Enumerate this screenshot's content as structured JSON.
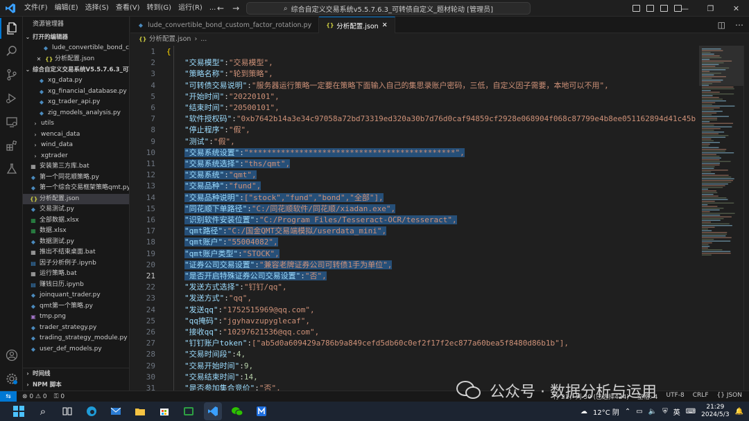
{
  "titlebar": {
    "menus": [
      "文件(F)",
      "编辑(E)",
      "选择(S)",
      "查看(V)",
      "转到(G)",
      "运行(R)",
      "..."
    ],
    "command_center": "综合自定义交易系统v5.5.7.6.3_可转债自定义_题材轮动 [管理员]"
  },
  "sidebar": {
    "header": "资源管理器",
    "open_editors_title": "打开的编辑器",
    "open_editors": [
      {
        "name": "lude_convertible_bond_c...",
        "type": "py"
      },
      {
        "name": "分析配置.json",
        "type": "json"
      }
    ],
    "workspace_title": "综合自定义交易系统V5.5.7.6.3_可转...",
    "files": [
      {
        "name": "xg_data.py",
        "type": "py",
        "kind": "file"
      },
      {
        "name": "xg_financial_database.py",
        "type": "py",
        "kind": "file"
      },
      {
        "name": "xg_trader_api.py",
        "type": "py",
        "kind": "file"
      },
      {
        "name": "zig_models_analysis.py",
        "type": "py",
        "kind": "file"
      },
      {
        "name": "utils",
        "type": "folder",
        "kind": "folder"
      },
      {
        "name": "wencai_data",
        "type": "folder",
        "kind": "folder"
      },
      {
        "name": "wind_data",
        "type": "folder",
        "kind": "folder"
      },
      {
        "name": "xgtrader",
        "type": "folder",
        "kind": "folder"
      },
      {
        "name": "安装第三方库.bat",
        "type": "bat",
        "kind": "file"
      },
      {
        "name": "第一个同花顺策略.py",
        "type": "py",
        "kind": "file"
      },
      {
        "name": "第一个综合交易框架策略qmt.py",
        "type": "py",
        "kind": "file"
      },
      {
        "name": "分析配置.json",
        "type": "json",
        "kind": "file",
        "selected": true
      },
      {
        "name": "交易测试.py",
        "type": "py",
        "kind": "file"
      },
      {
        "name": "全部数据.xlsx",
        "type": "xlsx",
        "kind": "file"
      },
      {
        "name": "数据.xlsx",
        "type": "xlsx",
        "kind": "file"
      },
      {
        "name": "数据测试.py",
        "type": "py",
        "kind": "file"
      },
      {
        "name": "推出不结束桌面.bat",
        "type": "bat",
        "kind": "file"
      },
      {
        "name": "因子分析例子.ipynb",
        "type": "ipynb",
        "kind": "file"
      },
      {
        "name": "运行策略.bat",
        "type": "bat",
        "kind": "file"
      },
      {
        "name": "赚钱日历.ipynb",
        "type": "ipynb",
        "kind": "file"
      },
      {
        "name": "joinquant_trader.py",
        "type": "py",
        "kind": "file"
      },
      {
        "name": "qmt第一个策略.py",
        "type": "py",
        "kind": "file"
      },
      {
        "name": "tmp.png",
        "type": "png",
        "kind": "file"
      },
      {
        "name": "trader_strategy.py",
        "type": "py",
        "kind": "file"
      },
      {
        "name": "trading_strategy_module.py",
        "type": "py",
        "kind": "file"
      },
      {
        "name": "user_def_models.py",
        "type": "py",
        "kind": "file"
      }
    ],
    "bottom_sections": [
      "时间线",
      "NPM 脚本"
    ]
  },
  "tabs": [
    {
      "name": "lude_convertible_bond_custom_factor_rotation.py",
      "type": "py",
      "active": false
    },
    {
      "name": "分析配置.json",
      "type": "json",
      "active": true
    }
  ],
  "breadcrumb": [
    "分析配置.json",
    "..."
  ],
  "editor": {
    "current_line": 21,
    "lines": [
      {
        "n": 1,
        "raw": "{"
      },
      {
        "n": 2,
        "k": "交易模型",
        "v": "\"交易模型\","
      },
      {
        "n": 3,
        "k": "策略名称",
        "v": "\"轮到策略\","
      },
      {
        "n": 4,
        "k": "可转债交易说明",
        "v": "\"服务器运行策略一定要在策略下面输入自己的集思录账户密码，三低，自定义因子需要，本地可以不用\","
      },
      {
        "n": 5,
        "k": "开始时间",
        "v": "\"20220101\","
      },
      {
        "n": 6,
        "k": "结束时间",
        "v": "\"20500101\","
      },
      {
        "n": 7,
        "k": "软件授权码",
        "v": "\"0xb7642b14a3e34c97058a72bd73319ed320a30b7d76d0caf94859cf2928e068904f068c87799e4b8ee051162894d41c45b"
      },
      {
        "n": 8,
        "k": "停止程序",
        "v": "\"假\","
      },
      {
        "n": 9,
        "k": "测试",
        "v": "\"假\","
      },
      {
        "n": 10,
        "k": "交易系统设置",
        "v": "\"*********************************************\",",
        "sel": true
      },
      {
        "n": 11,
        "k": "交易系统选择",
        "v": "\"ths/qmt\",",
        "sel": true
      },
      {
        "n": 12,
        "k": "交易系统",
        "v": "\"qmt\",",
        "sel": true
      },
      {
        "n": 13,
        "k": "交易品种",
        "v": "\"fund\",",
        "sel": true
      },
      {
        "n": 14,
        "k": "交易品种说明",
        "v": "[\"stock\",\"fund\",\"bond\",\"全部\"],",
        "sel": true
      },
      {
        "n": 15,
        "k": "同花顺下单路径",
        "v": "\"C:/同花顺软件/同花顺/xiadan.exe\",",
        "sel": true
      },
      {
        "n": 16,
        "k": "识别软件安装位置",
        "v": "\"C:/Program Files/Tesseract-OCR/tesseract\",",
        "sel": true
      },
      {
        "n": 17,
        "k": "qmt路径",
        "v": "\"C:/国金QMT交易端模拟/userdata_mini\",",
        "sel": true
      },
      {
        "n": 18,
        "k": "qmt账户",
        "v": "\"55004082\",",
        "sel": true
      },
      {
        "n": 19,
        "k": "qmt账户类型",
        "v": "\"STOCK\",",
        "sel": true
      },
      {
        "n": 20,
        "k": "证券公司交易设置",
        "v": "\"兼容老牌证券公司可转债1手为单位\",",
        "sel": true
      },
      {
        "n": 21,
        "k": "是否开启特殊证券公司交易设置",
        "v": "\"否\",",
        "sel": true
      },
      {
        "n": 22,
        "k": "发送方式选择",
        "v": "\"钉钉/qq\","
      },
      {
        "n": 23,
        "k": "发送方式",
        "v": "\"qq\","
      },
      {
        "n": 24,
        "k": "发送qq",
        "v": "\"1752515969@qq.com\","
      },
      {
        "n": 25,
        "k": "qq掩码",
        "v": "\"jgyhavzupyglecaf\","
      },
      {
        "n": 26,
        "k": "接收qq",
        "v": "\"1029762153б@qq.com\","
      },
      {
        "n": 27,
        "k": "钉钉账户token",
        "v": "[\"ab5d0a609429a786b9a849cefd5db60c0ef2f17f2ec877a60bea5f8480d86b1b\"],"
      },
      {
        "n": 28,
        "k": "交易时间段",
        "v": "4,"
      },
      {
        "n": 29,
        "k": "交易开始时间",
        "v": "9,"
      },
      {
        "n": 30,
        "k": "交易结束时间",
        "v": "14,"
      },
      {
        "n": 31,
        "k": "是否参加集合竞价",
        "v": "\"否\","
      }
    ]
  },
  "statusbar": {
    "left": [
      "⊗ 0  ⚠ 0",
      "⚿ 0"
    ],
    "right": [
      "行 21，列 30 (已选择424)",
      "空格: 4",
      "UTF-8",
      "CRLF",
      "{} JSON"
    ]
  },
  "taskbar": {
    "weather": "12°C 阴",
    "ime": "英",
    "time": "21:29",
    "date": "2024/5/3"
  },
  "watermark": "公众号 · 数据分析与运用",
  "colors": {
    "accent": "#0078d4",
    "selection": "#264f78",
    "json_key": "#9cdcfe",
    "json_string": "#ce9178",
    "json_number": "#b5cea8"
  }
}
